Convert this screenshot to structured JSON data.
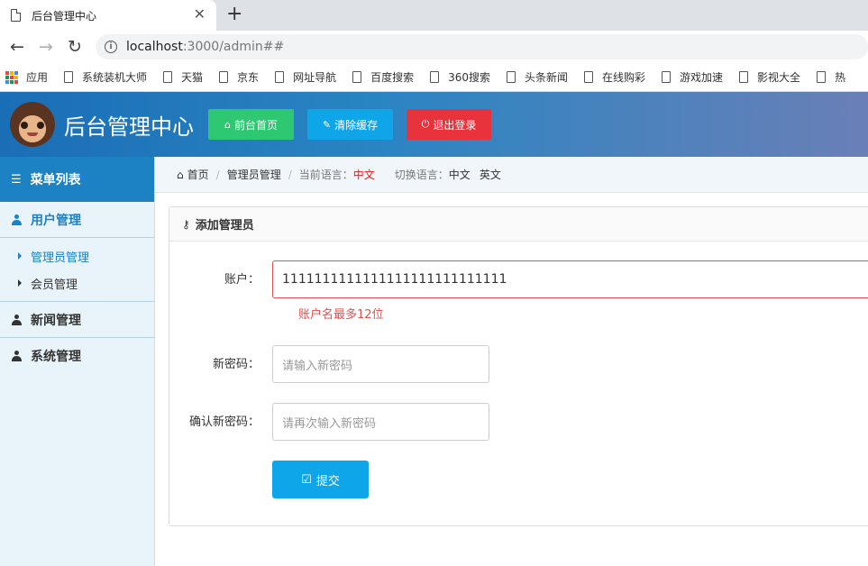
{
  "browser": {
    "tab_title": "后台管理中心",
    "tab_close": "✕",
    "new_tab": "+",
    "url_host": "localhost",
    "url_rest": ":3000/admin##",
    "bookmarks": [
      "系统装机大师",
      "天猫",
      "京东",
      "网址导航",
      "百度搜索",
      "360搜索",
      "头条新闻",
      "在线购彩",
      "游戏加速",
      "影视大全",
      "热"
    ],
    "apps_label": "应用"
  },
  "header": {
    "title": "后台管理中心",
    "buttons": {
      "home": "前台首页",
      "clear_cache": "清除缓存",
      "logout": "退出登录"
    },
    "colors": {
      "home": "#2dc871",
      "clear_cache": "#0ea5e9",
      "logout": "#e8323c"
    }
  },
  "sidebar": {
    "heading": "菜单列表",
    "groups": [
      {
        "label": "用户管理",
        "items": [
          "管理员管理",
          "会员管理"
        ]
      },
      {
        "label": "新闻管理"
      },
      {
        "label": "系统管理"
      }
    ]
  },
  "breadcrumb": {
    "home": "首页",
    "current": "管理员管理",
    "lang_label": "当前语言：",
    "lang_value": "中文",
    "switch_label": "切换语言：",
    "switch_options": [
      "中文",
      "英文"
    ]
  },
  "form": {
    "title": "添加管理员",
    "account_label": "账户：",
    "account_value": "1111111111111111111111111111",
    "account_error": "账户名最多12位",
    "password_label": "新密码：",
    "password_placeholder": "请输入新密码",
    "confirm_label": "确认新密码：",
    "confirm_placeholder": "请再次输入新密码",
    "submit_label": "提交"
  }
}
